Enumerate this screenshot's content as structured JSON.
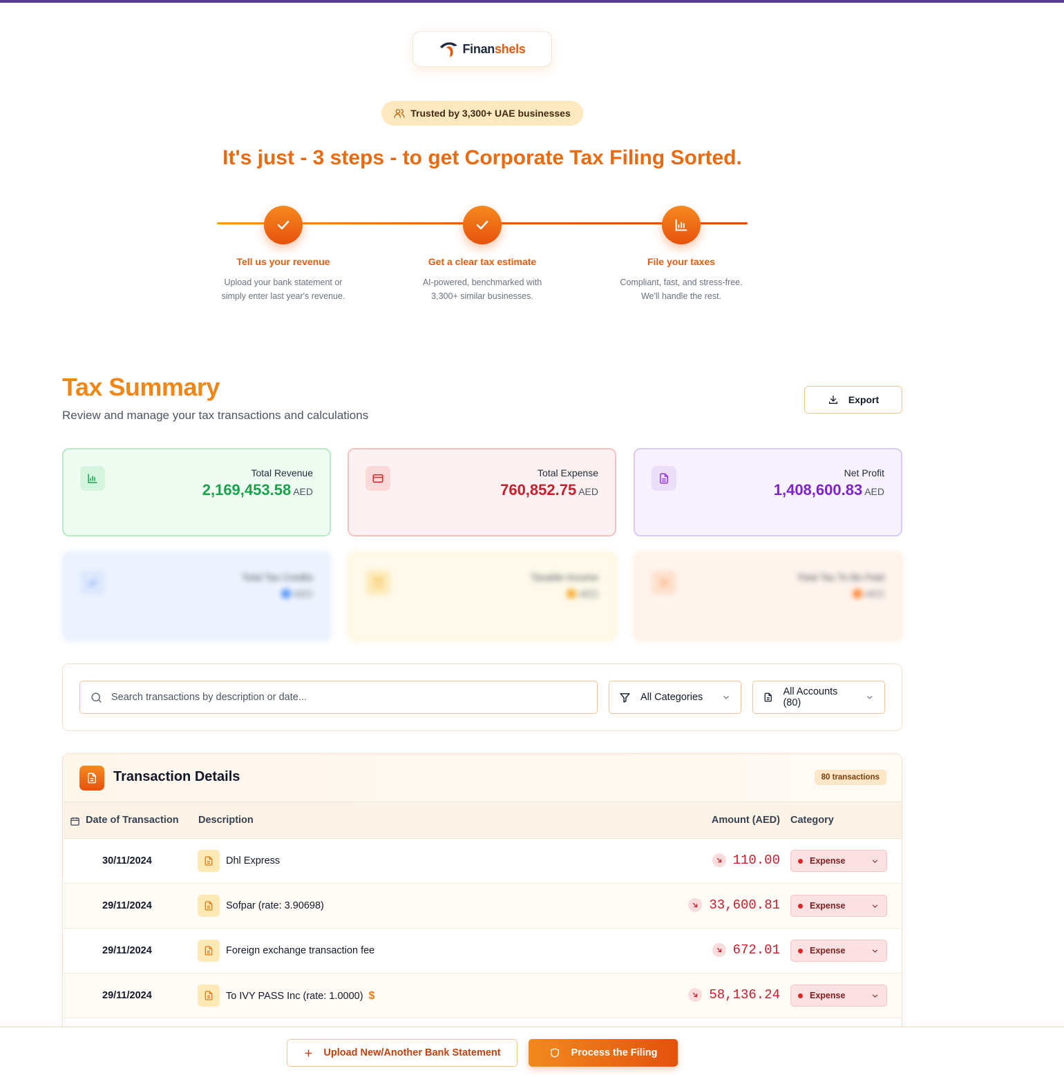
{
  "brand": {
    "name_part1": "Finan",
    "name_part2": "shels",
    "accent": "#ea580c"
  },
  "trust": {
    "text": "Trusted by 3,300+ UAE businesses",
    "icon": "users-icon"
  },
  "hero": {
    "title": "It's just - 3 steps - to get Corporate Tax Filing Sorted."
  },
  "steps": [
    {
      "title": "Tell us your revenue",
      "desc_line1": "Upload your bank statement or",
      "desc_line2": "simply enter last year's revenue.",
      "icon": "check-icon",
      "status": "complete"
    },
    {
      "title": "Get a clear tax estimate",
      "desc_line1": "AI-powered, benchmarked with",
      "desc_line2": "3,300+ similar businesses.",
      "icon": "check-icon",
      "status": "complete"
    },
    {
      "title": "File your taxes",
      "desc_line1": "Compliant, fast, and stress-free.",
      "desc_line2": "We'll handle the rest.",
      "icon": "bar-chart-icon",
      "status": "current"
    }
  ],
  "summary": {
    "title": "Tax Summary",
    "subtitle": "Review and manage your tax transactions and calculations",
    "export_label": "Export",
    "cards": [
      {
        "label": "Total Revenue",
        "value": "2,169,453.58",
        "unit": "AED",
        "color": "#16a34a",
        "icon": "bar-chart-icon"
      },
      {
        "label": "Total Expense",
        "value": "760,852.75",
        "unit": "AED",
        "color": "#c81e2c",
        "icon": "credit-card-icon"
      },
      {
        "label": "Net Profit",
        "value": "1,408,600.83",
        "unit": "AED",
        "color": "#7e22ce",
        "icon": "document-icon"
      }
    ],
    "locked_cards": [
      {
        "label": "Total Tax Credits",
        "unit": "AED",
        "color": "#3b82f6",
        "icon": "check-icon"
      },
      {
        "label": "Taxable Income",
        "unit": "AED",
        "color": "#f59e0b",
        "icon": "calculator-icon"
      },
      {
        "label": "Total Tax To Be Paid",
        "unit": "AED",
        "color": "#f97316",
        "icon": "tax-icon"
      }
    ]
  },
  "filters": {
    "search_placeholder": "Search transactions by description or date...",
    "category_selected": "All Categories",
    "account_selected": "All Accounts (80)"
  },
  "transactions": {
    "title": "Transaction Details",
    "count_badge": "80 transactions",
    "columns": {
      "date": "Date of Transaction",
      "description": "Description",
      "amount": "Amount (AED)",
      "category": "Category"
    },
    "rows": [
      {
        "date": "30/11/2024",
        "description": "Dhl Express",
        "amount": "110.00",
        "category": "Expense",
        "flag": ""
      },
      {
        "date": "29/11/2024",
        "description": "Sofpar (rate: 3.90698)",
        "amount": "33,600.81",
        "category": "Expense",
        "flag": ""
      },
      {
        "date": "29/11/2024",
        "description": "Foreign exchange transaction fee",
        "amount": "672.01",
        "category": "Expense",
        "flag": ""
      },
      {
        "date": "29/11/2024",
        "description": "To IVY PASS Inc (rate: 1.0000)",
        "amount": "58,136.24",
        "category": "Expense",
        "flag": "$"
      }
    ]
  },
  "actions": {
    "upload_label": "Upload New/Another Bank Statement",
    "process_label": "Process the Filing"
  }
}
